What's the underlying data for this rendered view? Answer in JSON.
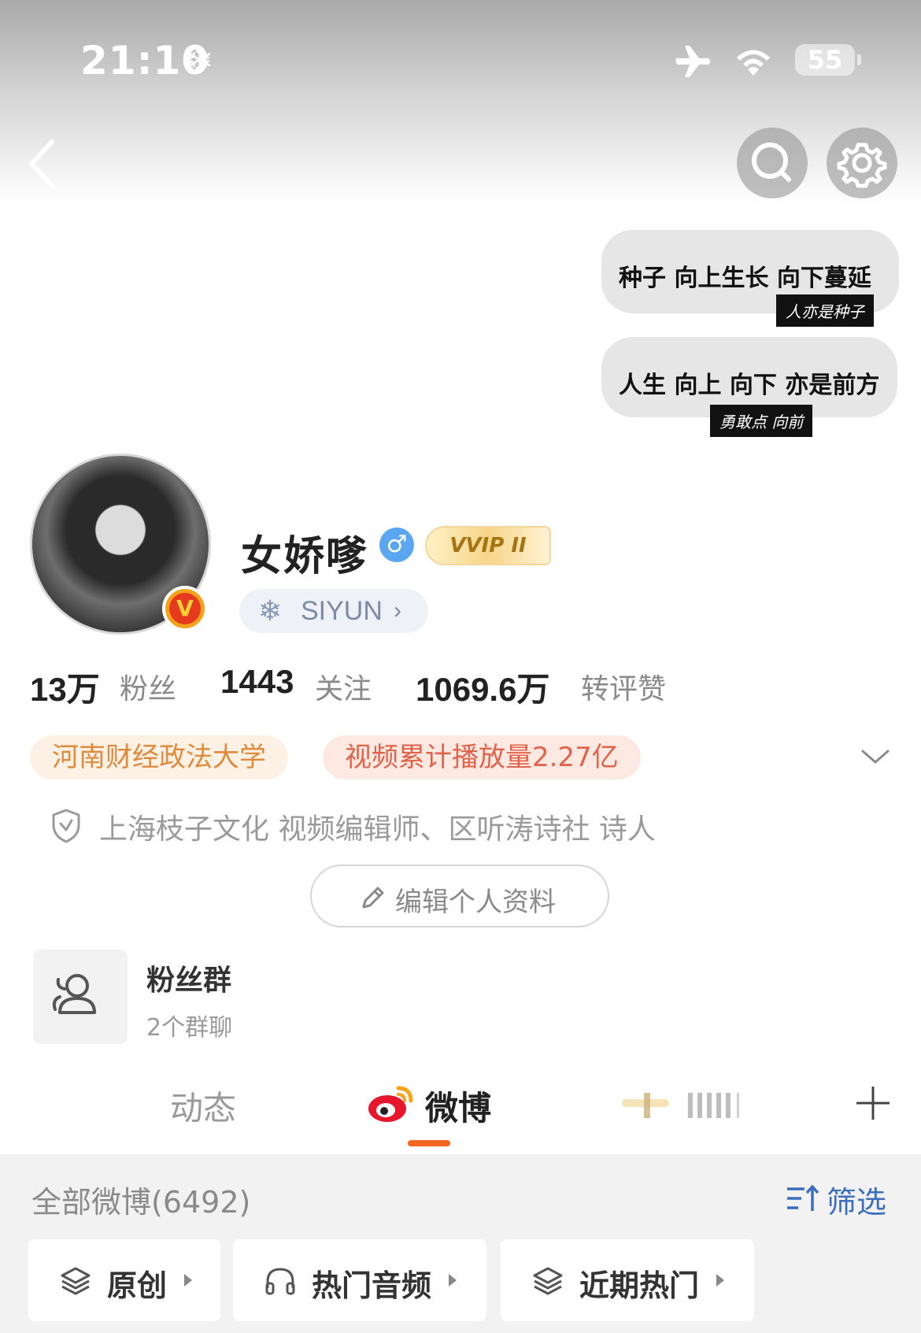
{
  "status_bar": {
    "time": "21:10",
    "battery": "55"
  },
  "bubbles": [
    {
      "text": "种子 向上生长 向下蔓延",
      "tag": "人亦是种子"
    },
    {
      "text": "人生 向上 向下 亦是前方",
      "tag": "勇敢点 向前"
    }
  ],
  "profile": {
    "name": "女娇嗲",
    "gender_symbol": "♂",
    "vip_label": "VVIP II",
    "group_label": "SIYUN",
    "stats": [
      {
        "value": "13万",
        "label": "粉丝"
      },
      {
        "value": "1443",
        "label": "关注"
      },
      {
        "value": "1069.6万",
        "label": "转评赞"
      }
    ],
    "tags": [
      "河南财经政法大学",
      "视频累计播放量2.27亿"
    ],
    "cert": "上海枝子文化 视频编辑师、区听涛诗社 诗人",
    "edit_button": "编辑个人资料"
  },
  "fan_group": {
    "title": "粉丝群",
    "subtitle": "2个群聊"
  },
  "tabs": {
    "dongtai": "动态",
    "weibo": "微博"
  },
  "feed": {
    "all_label": "全部微博(6492)",
    "filter_label": "筛选",
    "chips": [
      "原创",
      "热门音频",
      "近期热门"
    ]
  },
  "colors": {
    "accent": "#f26522",
    "filter_blue": "#3c6ebb"
  }
}
